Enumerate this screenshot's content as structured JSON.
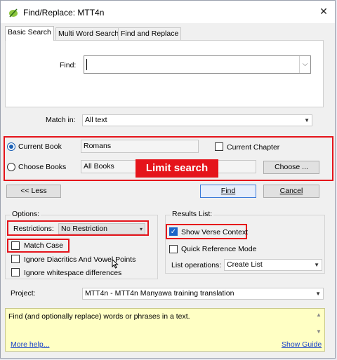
{
  "window": {
    "title": "Find/Replace: MTT4n"
  },
  "tabs": [
    {
      "label": "Basic Search",
      "active": true
    },
    {
      "label": "Multi Word Search",
      "active": false
    },
    {
      "label": "Find and Replace",
      "active": false
    }
  ],
  "find": {
    "label": "Find:",
    "value": ""
  },
  "match_in": {
    "label": "Match in:",
    "value": "All text"
  },
  "scope": {
    "current_book_label": "Current Book",
    "current_book_value": "Romans",
    "current_book_selected": true,
    "choose_books_label": "Choose Books",
    "choose_books_value": "All Books",
    "current_chapter_label": "Current Chapter",
    "choose_button": "Choose ..."
  },
  "callout": "Limit search",
  "buttons": {
    "less": "<< Less",
    "find": "Find",
    "cancel": "Cancel"
  },
  "options": {
    "title": "Options:",
    "restrictions_label": "Restrictions:",
    "restrictions_value": "No Restriction",
    "match_case": "Match Case",
    "ignore_diacritics": "Ignore Diacritics And Vowel Points",
    "ignore_whitespace": "Ignore whitespace differences"
  },
  "results": {
    "title": "Results List:",
    "show_verse_context": "Show Verse Context",
    "show_verse_context_checked": true,
    "quick_reference": "Quick Reference Mode",
    "list_operations_label": "List operations:",
    "list_operations_value": "Create List"
  },
  "project": {
    "label": "Project:",
    "value": "MTT4n -  MTT4n Manyawa training translation"
  },
  "help": {
    "text": "Find (and optionally replace) words or phrases in a text.",
    "more_help": "More help...",
    "show_guide": "Show Guide"
  },
  "colors": {
    "annotation_red": "#e5141b",
    "accent_blue": "#1a64c8",
    "help_yellow": "#ffffc4"
  },
  "icons": {
    "app": "paratext-leaf-icon",
    "close": "close-icon"
  }
}
